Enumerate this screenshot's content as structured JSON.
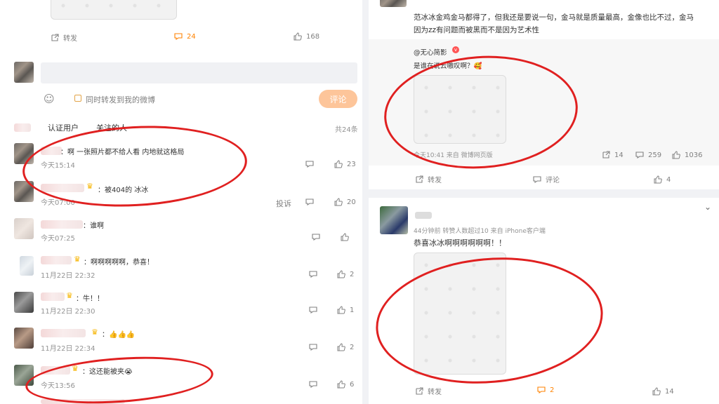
{
  "left": {
    "top_actions": {
      "repost": "转发",
      "comments": "24",
      "likes": "168"
    },
    "compose": {
      "placeholder": "",
      "repost_checkbox_label": "同时转发到我的微博",
      "comment_button": "评论"
    },
    "filter_tabs": [
      "认证用户",
      "关注的人"
    ],
    "total": "共24条",
    "report": "投诉",
    "comments": [
      {
        "text": "：啊 一张照片都不给人看 内地就这格局",
        "time": "今天15:14",
        "likes": "23",
        "crown": false
      },
      {
        "text": "：被404的 冰冰",
        "time": "今天07:00",
        "likes": "20",
        "crown": true
      },
      {
        "text": "：谁啊",
        "time": "今天07:25",
        "likes": "",
        "crown": false
      },
      {
        "text": "：啊啊啊啊啊，恭喜！",
        "time": "11月22日 22:32",
        "likes": "2",
        "crown": true
      },
      {
        "text": "：牛！！",
        "time": "11月22日 22:30",
        "likes": "1",
        "crown": true
      },
      {
        "text": "：👍👍👍",
        "time": "11月22日 22:34",
        "likes": "2",
        "crown": true
      },
      {
        "text": "：这还能被夹😭",
        "time": "今天13:56",
        "likes": "6",
        "crown": true
      }
    ]
  },
  "right_top": {
    "post_text_line1": "范冰冰金鸡金马都得了，但我还是要说一句，金马就是质量最高，金像也比不过，金马",
    "post_text_line2": "因为zz有问题而被黑而不是因为艺术性",
    "quote_author": "@无心简影",
    "quote_text": "是谁在说云嗷叹啊？🥰",
    "quote_meta": "今天10:41 来自 微博网页版",
    "quote_stats": {
      "reposts": "14",
      "comments": "259",
      "likes": "1036"
    },
    "actions": {
      "repost": "转发",
      "comment": "评论",
      "likes": "4"
    }
  },
  "right_bottom": {
    "meta": "44分钟前 转赞人数超过10 来自 iPhone客户端",
    "text": "恭喜冰冰啊啊啊啊啊啊！！",
    "actions": {
      "repost": "转发",
      "comments": "2",
      "likes": "14"
    }
  },
  "colors": {
    "accent": "#ff8200",
    "annotation": "#e02020",
    "comment_button": "#fdc59a"
  }
}
